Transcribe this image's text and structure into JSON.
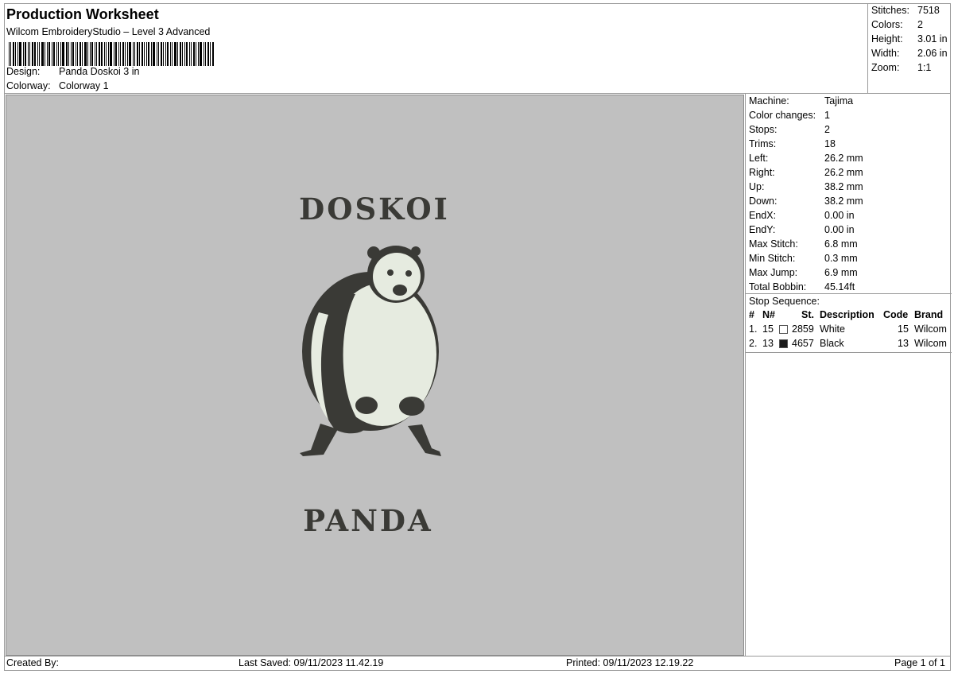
{
  "header": {
    "title": "Production Worksheet",
    "subtitle": "Wilcom EmbroideryStudio – Level 3 Advanced",
    "design_label": "Design:",
    "design_value": "Panda Doskoi 3 in",
    "colorway_label": "Colorway:",
    "colorway_value": "Colorway 1"
  },
  "summary": [
    {
      "label": "Stitches:",
      "value": "7518"
    },
    {
      "label": "Colors:",
      "value": "2"
    },
    {
      "label": "Height:",
      "value": "3.01 in"
    },
    {
      "label": "Width:",
      "value": "2.06 in"
    },
    {
      "label": "Zoom:",
      "value": "1:1"
    }
  ],
  "machine_info": [
    {
      "label": "Machine:",
      "value": "Tajima"
    },
    {
      "label": "Color changes:",
      "value": "1"
    },
    {
      "label": "Stops:",
      "value": "2"
    },
    {
      "label": "Trims:",
      "value": "18"
    },
    {
      "label": "Left:",
      "value": "26.2 mm"
    },
    {
      "label": "Right:",
      "value": "26.2 mm"
    },
    {
      "label": "Up:",
      "value": "38.2 mm"
    },
    {
      "label": "Down:",
      "value": "38.2 mm"
    },
    {
      "label": "EndX:",
      "value": "0.00 in"
    },
    {
      "label": "EndY:",
      "value": "0.00 in"
    },
    {
      "label": "Max Stitch:",
      "value": "6.8 mm"
    },
    {
      "label": "Min Stitch:",
      "value": "0.3 mm"
    },
    {
      "label": "Max Jump:",
      "value": "6.9 mm"
    },
    {
      "label": "Total Bobbin:",
      "value": "45.14ft"
    }
  ],
  "stop_sequence": {
    "title": "Stop Sequence:",
    "columns": [
      "#",
      "N#",
      "St.",
      "Description",
      "Code",
      "Brand"
    ],
    "rows": [
      {
        "num": "1.",
        "n": "15",
        "st": "2859",
        "description": "White",
        "code": "15",
        "brand": "Wilcom",
        "swatch": "#ffffff"
      },
      {
        "num": "2.",
        "n": "13",
        "st": "4657",
        "description": "Black",
        "code": "13",
        "brand": "Wilcom",
        "swatch": "#1a1a1a"
      }
    ]
  },
  "design": {
    "text_top": "DOSKOI",
    "text_bottom": "PANDA",
    "thread_dark": "#3a3a36",
    "thread_light": "#e6ebe0",
    "background": "#c0c0c0"
  },
  "footer": {
    "created_by": "Created By:",
    "last_saved": "Last Saved: 09/11/2023 11.42.19",
    "printed": "Printed: 09/11/2023 12.19.22",
    "page": "Page 1 of 1"
  }
}
